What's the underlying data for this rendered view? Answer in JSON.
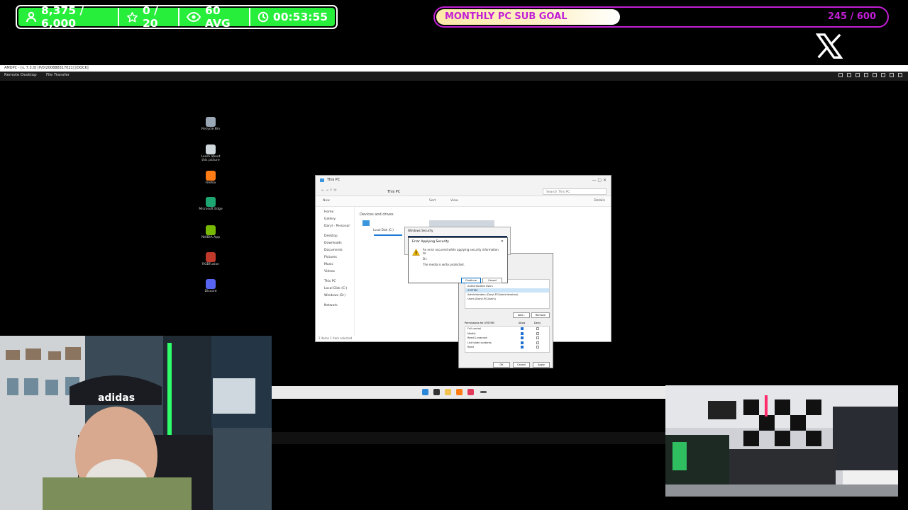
{
  "stats": {
    "followers": "8,375 / 6,000",
    "stars": "0 / 20",
    "viewers": "60 AVG",
    "uptime": "00:53:55"
  },
  "goal": {
    "title": "MONTHLY PC SUB GOAL",
    "count": "245 / 600",
    "progress_fraction": 0.408
  },
  "remote_desktop": {
    "title": "AMDPC - [v. 7.3.0] [P/0/200888317021] [DOCK]",
    "tabs": [
      "Remote Desktop",
      "File Transfer"
    ]
  },
  "desktop_icons": [
    {
      "label": "Recycle Bin",
      "color": "#9aa7b5"
    },
    {
      "label": "Learn about this picture",
      "color": "#cfd8dc"
    },
    {
      "label": "Firefox",
      "color": "#ff7b16"
    },
    {
      "label": "Microsoft Edge",
      "color": "#1ea672"
    },
    {
      "label": "NVIDIA App",
      "color": "#76b900"
    },
    {
      "label": "RGBFusion",
      "color": "#c0392b"
    },
    {
      "label": "Discord",
      "color": "#5865f2"
    }
  ],
  "explorer": {
    "title": "This PC",
    "address": "This PC",
    "search_placeholder": "Search This PC",
    "toolbar": [
      "New",
      "Sort",
      "View",
      "Details"
    ],
    "group_header": "Devices and drives",
    "sidebar": [
      "Home",
      "Gallery",
      "Daryl - Personal",
      "Desktop",
      "Downloads",
      "Documents",
      "Pictures",
      "Music",
      "Videos",
      "This PC",
      "Local Disk (C:)",
      "Windows (D:)",
      "Network"
    ],
    "drives": [
      "Local Disk (C:)",
      "Windows (D:)"
    ],
    "status": "2 items   1 item selected"
  },
  "security_dialog": {
    "title": "Windows Security"
  },
  "error_dialog": {
    "title": "Error Applying Security",
    "message_line1": "An error occurred while applying security information to:",
    "message_line2": "D:\\",
    "message_line3": "The media is write protected.",
    "continue_label": "Continue",
    "cancel_label": "Cancel"
  },
  "perm_dialog": {
    "users": [
      "SYSTEM",
      "Authenticated Users",
      "SYSTEM",
      "Administrators (Daryl-PC\\Administrators)",
      "Users (Daryl-PC\\Users)"
    ],
    "perm_header": "Permissions for SYSTEM",
    "perm_cols": [
      "Allow",
      "Deny"
    ],
    "perms": [
      "Full control",
      "Modify",
      "Read & execute",
      "List folder contents",
      "Read"
    ],
    "buttons": [
      "OK",
      "Cancel",
      "Apply"
    ],
    "add_label": "Add...",
    "remove_label": "Remove"
  },
  "colors": {
    "stat_green": "#27ee3a",
    "goal_purple": "#c21fd6"
  }
}
